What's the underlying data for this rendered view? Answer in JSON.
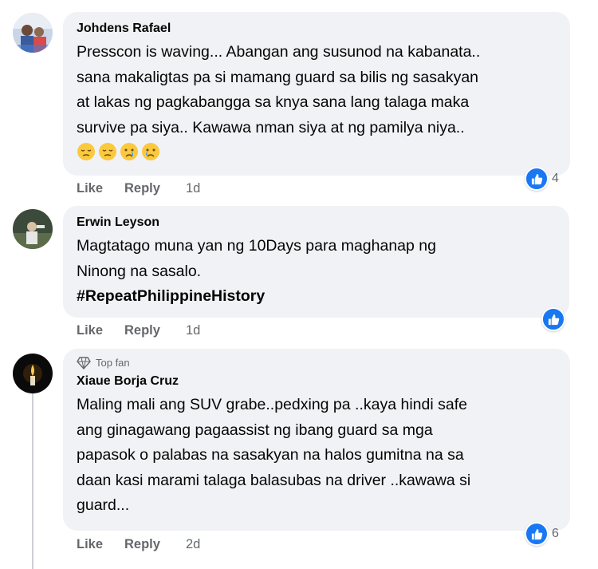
{
  "comments": [
    {
      "author": "Johdens Rafael",
      "lines": [
        "Presscon is waving... Abangan ang susunod na kabanata..",
        "sana makaligtas pa si mamang guard sa bilis ng sasakyan",
        "at lakas ng pagkabangga sa knya sana lang talaga maka",
        "survive pa siya.. Kawawa nman siya at ng pamilya niya.."
      ],
      "emojis": [
        "pensive-face",
        "pensive-face",
        "crying-face",
        "sad-face"
      ],
      "reaction_count": "4",
      "like_label": "Like",
      "reply_label": "Reply",
      "time": "1d"
    },
    {
      "author": "Erwin Leyson",
      "lines": [
        "Magtatago muna yan ng 10Days para maghanap ng",
        "Ninong na sasalo."
      ],
      "hashtag": "#RepeatPhilippineHistory",
      "reaction_count": "",
      "like_label": "Like",
      "reply_label": "Reply",
      "time": "1d"
    },
    {
      "badge": "Top fan",
      "author": "Xiaue Borja Cruz",
      "lines": [
        "Maling mali ang SUV grabe..pedxing pa ..kaya hindi safe",
        "ang ginagawang pagaassist ng ibang guard sa mga",
        "papasok o palabas na sasakyan na halos gumitna na sa",
        "daan kasi marami talaga balasubas na driver ..kawawa si",
        "guard..."
      ],
      "reaction_count": "6",
      "like_label": "Like",
      "reply_label": "Reply",
      "time": "2d"
    }
  ],
  "colors": {
    "bubble": "#f0f2f5",
    "text": "#050505",
    "secondary": "#65676b",
    "like_blue": "#1877f2"
  }
}
